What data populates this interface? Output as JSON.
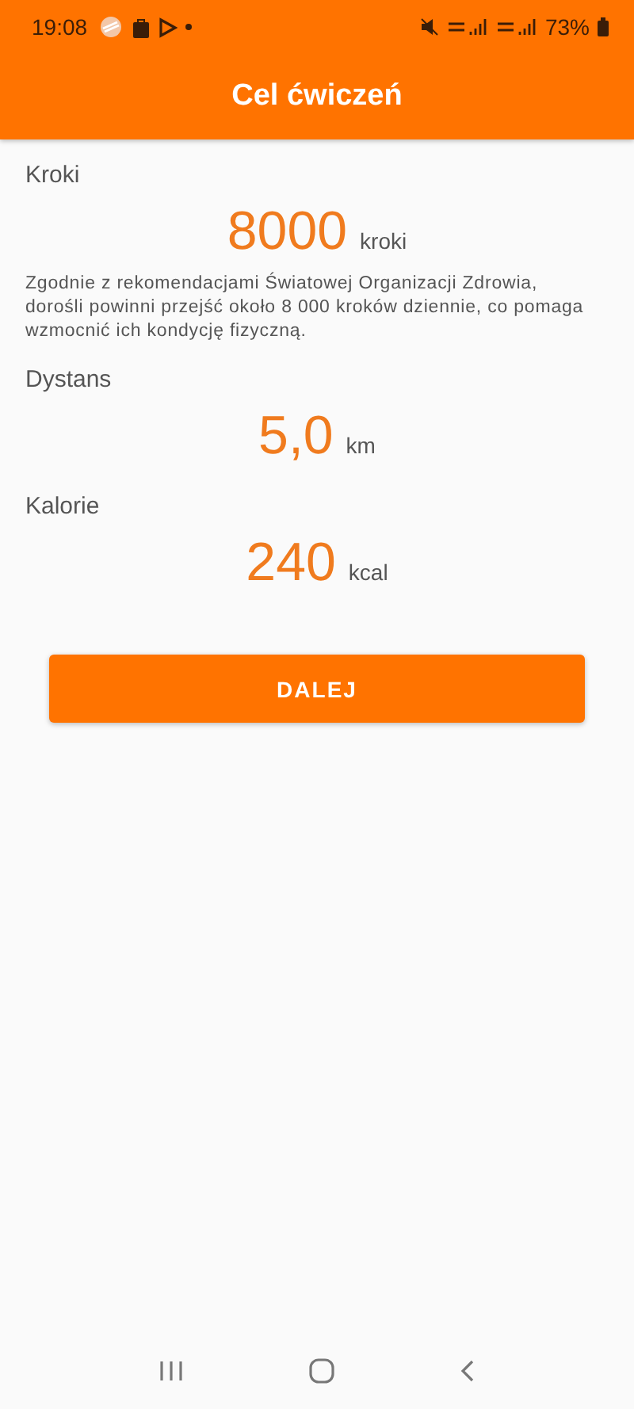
{
  "status_bar": {
    "time": "19:08",
    "battery": "73%"
  },
  "header": {
    "title": "Cel ćwiczeń"
  },
  "goals": [
    {
      "label": "Kroki",
      "value": "8000",
      "unit": "kroki",
      "note": "Zgodnie z rekomendacjami Światowej Organizacji Zdrowia, dorośli powinni przejść około 8 000 kroków dziennie, co pomaga wzmocnić ich kondycję fizyczną."
    },
    {
      "label": "Dystans",
      "value": "5,0",
      "unit": "km"
    },
    {
      "label": "Kalorie",
      "value": "240",
      "unit": "kcal"
    }
  ],
  "button": {
    "label": "DALEJ"
  }
}
